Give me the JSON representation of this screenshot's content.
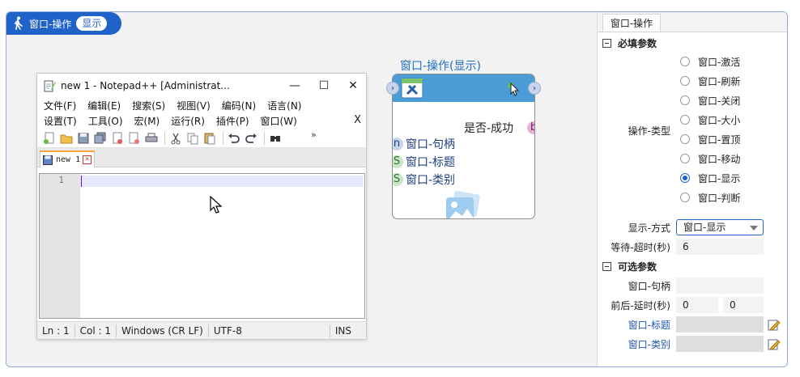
{
  "header": {
    "title": "窗口-操作",
    "badge": "显示"
  },
  "notepad": {
    "caption": "new 1 - Notepad++ [Administrat...",
    "controls": {
      "minimize": "—",
      "maximize": "☐",
      "close": "✕"
    },
    "menu_row1": [
      "文件(F)",
      "编辑(E)",
      "搜索(S)",
      "视图(V)",
      "编码(N)",
      "语言(N)"
    ],
    "menu_row2": [
      "设置(T)",
      "工具(O)",
      "宏(M)",
      "运行(R)",
      "插件(P)",
      "窗口(W)"
    ],
    "menu_close": "X",
    "toolbar_more": "»",
    "tab_label": "new 1",
    "line_number": "1",
    "status": {
      "pos_ln": "Ln : 1",
      "pos_col": "Col : 1",
      "eol": "Windows (CR LF)",
      "enc": "UTF-8",
      "mode": "INS"
    }
  },
  "node": {
    "title": "窗口-操作(显示)",
    "output_label": "是否-成功",
    "output_type": "b",
    "inputs": [
      {
        "type": "n",
        "label": "窗口-句柄"
      },
      {
        "type": "S",
        "label": "窗口-标题"
      },
      {
        "type": "S",
        "label": "窗口-类别"
      }
    ],
    "colors": {
      "header": "#4a9bd6",
      "accent": "#1f63c9"
    }
  },
  "panel": {
    "tab": "窗口-操作",
    "required_title": "必填参数",
    "op_type_label": "操作-类型",
    "op_options": [
      "窗口-激活",
      "窗口-刷新",
      "窗口-关闭",
      "窗口-大小",
      "窗口-置顶",
      "窗口-移动",
      "窗口-显示",
      "窗口-判断"
    ],
    "op_selected": "窗口-显示",
    "show_mode_label": "显示-方式",
    "show_mode_value": "窗口-显示",
    "timeout_label": "等待-超时(秒)",
    "timeout_value": "6",
    "optional_title": "可选参数",
    "handle_label": "窗口-句柄",
    "handle_value": "",
    "delay_label": "前后-延时(秒)",
    "delay_before": "0",
    "delay_after": "0",
    "title_label": "窗口-标题",
    "class_label": "窗口-类别"
  }
}
